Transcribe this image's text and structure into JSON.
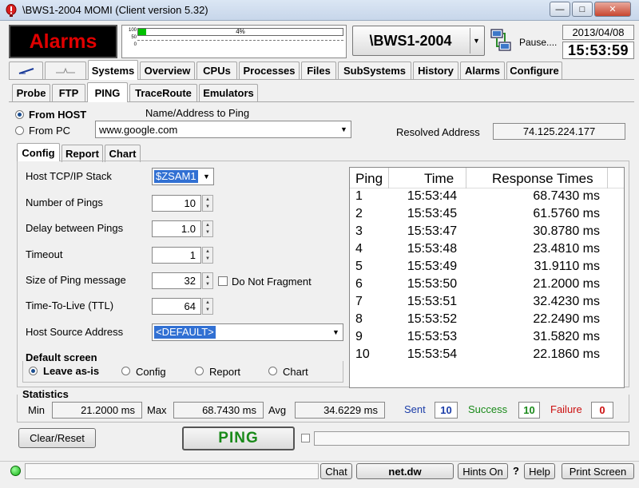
{
  "window": {
    "title": "\\BWS1-2004 MOMI (Client version 5.32)",
    "min": "—",
    "max": "□",
    "close": "✕"
  },
  "header": {
    "alarms_label": "Alarms",
    "gauge_scale": [
      "100",
      "50",
      "0"
    ],
    "gauge_percent": "4%",
    "gauge_value": 0.04,
    "system_name": "\\BWS1-2004",
    "pause_label": "Pause....",
    "date": "2013/04/08",
    "time": "15:53:59"
  },
  "main_tabs": [
    "Systems",
    "Overview",
    "CPUs",
    "Processes",
    "Files",
    "SubSystems",
    "History",
    "Alarms",
    "Configure"
  ],
  "sub_tabs": [
    "Probe",
    "FTP",
    "PING",
    "TraceRoute",
    "Emulators"
  ],
  "source": {
    "from_host": "From HOST",
    "from_pc": "From PC",
    "name_label": "Name/Address to Ping",
    "name_value": "www.google.com",
    "resolved_label": "Resolved Address",
    "resolved_value": "74.125.224.177"
  },
  "config_tabs": [
    "Config",
    "Report",
    "Chart"
  ],
  "config": {
    "stack_label": "Host TCP/IP Stack",
    "stack_value": "$ZSAM1",
    "num_pings_label": "Number of Pings",
    "num_pings": "10",
    "delay_label": "Delay between Pings",
    "delay": "1.0",
    "timeout_label": "Timeout",
    "timeout": "1",
    "size_label": "Size of Ping message",
    "size": "32",
    "dont_fragment": "Do Not Fragment",
    "ttl_label": "Time-To-Live (TTL)",
    "ttl": "64",
    "source_label": "Host Source Address",
    "source_value": "<DEFAULT>",
    "default_screen_label": "Default screen",
    "default_options": [
      "Leave as-is",
      "Config",
      "Report",
      "Chart"
    ]
  },
  "table": {
    "headers": [
      "Ping",
      "Time",
      "Response Times"
    ],
    "rows": [
      [
        "1",
        "15:53:44",
        "68.7430 ms"
      ],
      [
        "2",
        "15:53:45",
        "61.5760 ms"
      ],
      [
        "3",
        "15:53:47",
        "30.8780 ms"
      ],
      [
        "4",
        "15:53:48",
        "23.4810 ms"
      ],
      [
        "5",
        "15:53:49",
        "31.9110 ms"
      ],
      [
        "6",
        "15:53:50",
        "21.2000 ms"
      ],
      [
        "7",
        "15:53:51",
        "32.4230 ms"
      ],
      [
        "8",
        "15:53:52",
        "22.2490 ms"
      ],
      [
        "9",
        "15:53:53",
        "31.5820 ms"
      ],
      [
        "10",
        "15:53:54",
        "22.1860 ms"
      ]
    ]
  },
  "statistics": {
    "title": "Statistics",
    "min_label": "Min",
    "min": "21.2000 ms",
    "max_label": "Max",
    "max": "68.7430 ms",
    "avg_label": "Avg",
    "avg": "34.6229 ms",
    "sent_label": "Sent",
    "sent": "10",
    "success_label": "Success",
    "success": "10",
    "failure_label": "Failure",
    "failure": "0"
  },
  "actions": {
    "clear_reset": "Clear/Reset",
    "ping": "PING"
  },
  "statusbar": {
    "chat": "Chat",
    "network": "net.dw",
    "hints": "Hints On",
    "question": "?",
    "help": "Help",
    "print": "Print Screen"
  },
  "colors": {
    "alarm_red": "#e00000",
    "ping_green": "#1a8a1a",
    "sent_blue": "#1a3ca8",
    "success_green": "#1a8a1a",
    "failure_red": "#cc1010"
  }
}
